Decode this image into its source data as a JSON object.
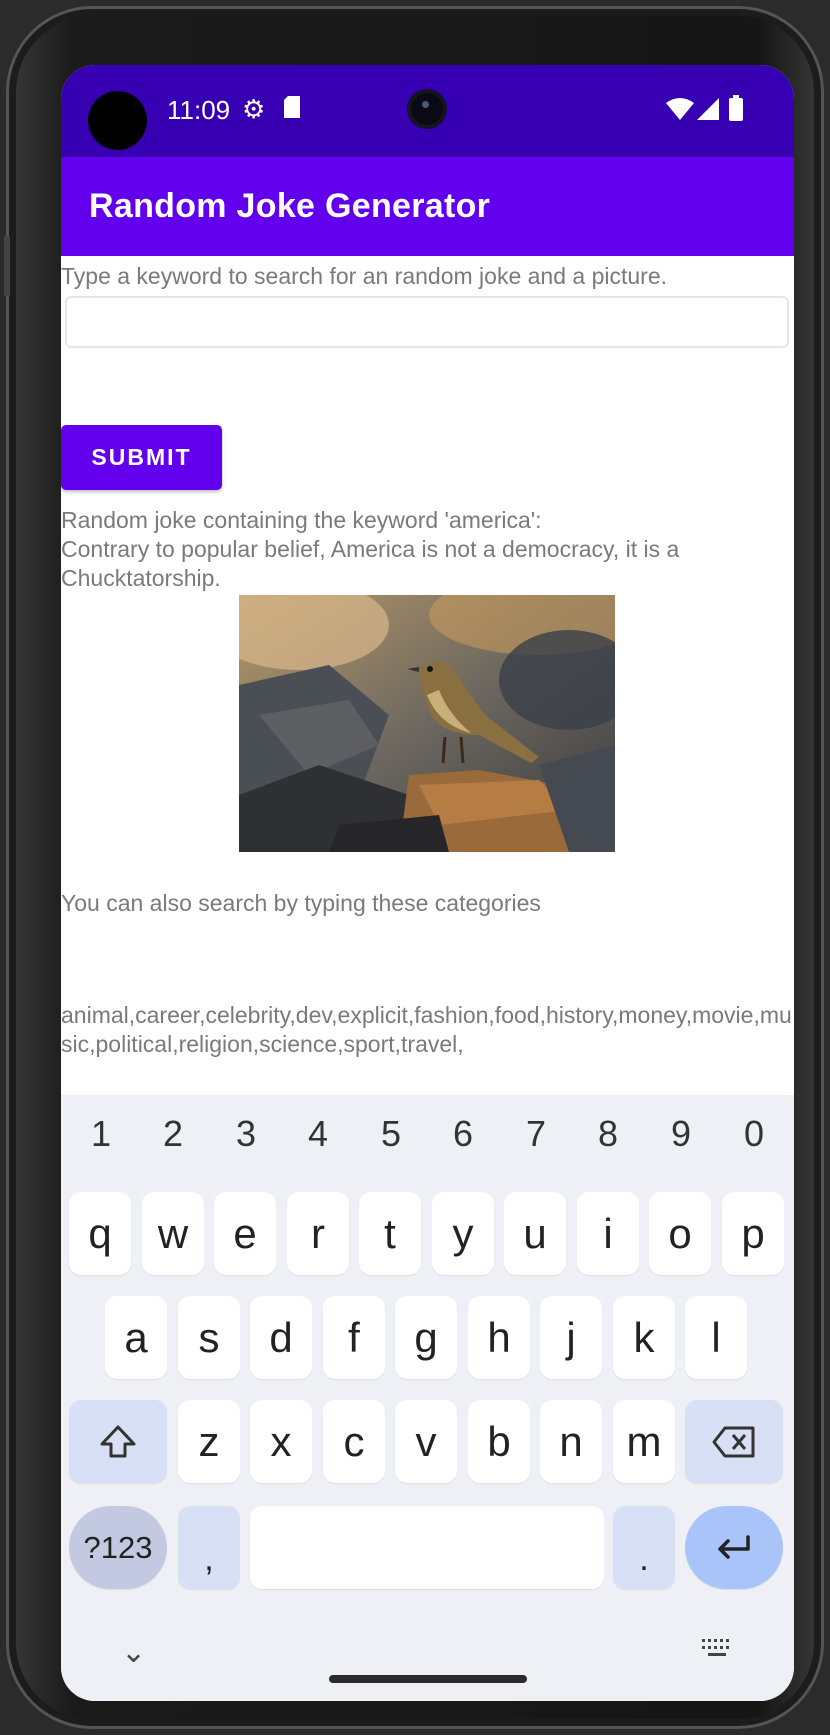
{
  "status_bar": {
    "time": "11:09",
    "settings_icon": "gear-icon",
    "sd_icon": "sd-card-icon",
    "wifi_icon": "wifi-icon",
    "signal_icon": "signal-icon",
    "battery_icon": "battery-icon"
  },
  "app_bar": {
    "title": "Random Joke Generator"
  },
  "form": {
    "instruction": "Type a keyword to search for an random joke and a picture.",
    "keyword_value": "",
    "submit_label": "SUBMIT"
  },
  "result": {
    "heading": "Random joke containing the keyword 'america':",
    "joke": "Contrary to popular belief, America is not a democracy, it is a Chucktatorship."
  },
  "categories": {
    "intro": "You can also search by typing these categories",
    "list": "animal,career,celebrity,dev,explicit,fashion,food,history,money,movie,music,political,religion,science,sport,travel,"
  },
  "keyboard": {
    "numbers": [
      "1",
      "2",
      "3",
      "4",
      "5",
      "6",
      "7",
      "8",
      "9",
      "0"
    ],
    "row1": [
      "q",
      "w",
      "e",
      "r",
      "t",
      "y",
      "u",
      "i",
      "o",
      "p"
    ],
    "row2": [
      "a",
      "s",
      "d",
      "f",
      "g",
      "h",
      "j",
      "k",
      "l"
    ],
    "row3": [
      "z",
      "x",
      "c",
      "v",
      "b",
      "n",
      "m"
    ],
    "symbols_label": "?123",
    "comma": ",",
    "period": "."
  },
  "colors": {
    "status_bar": "#3700b3",
    "app_bar": "#6200ee",
    "button": "#6200ee",
    "text": "#7a7a7a",
    "keyboard_bg": "#eef0f6"
  }
}
